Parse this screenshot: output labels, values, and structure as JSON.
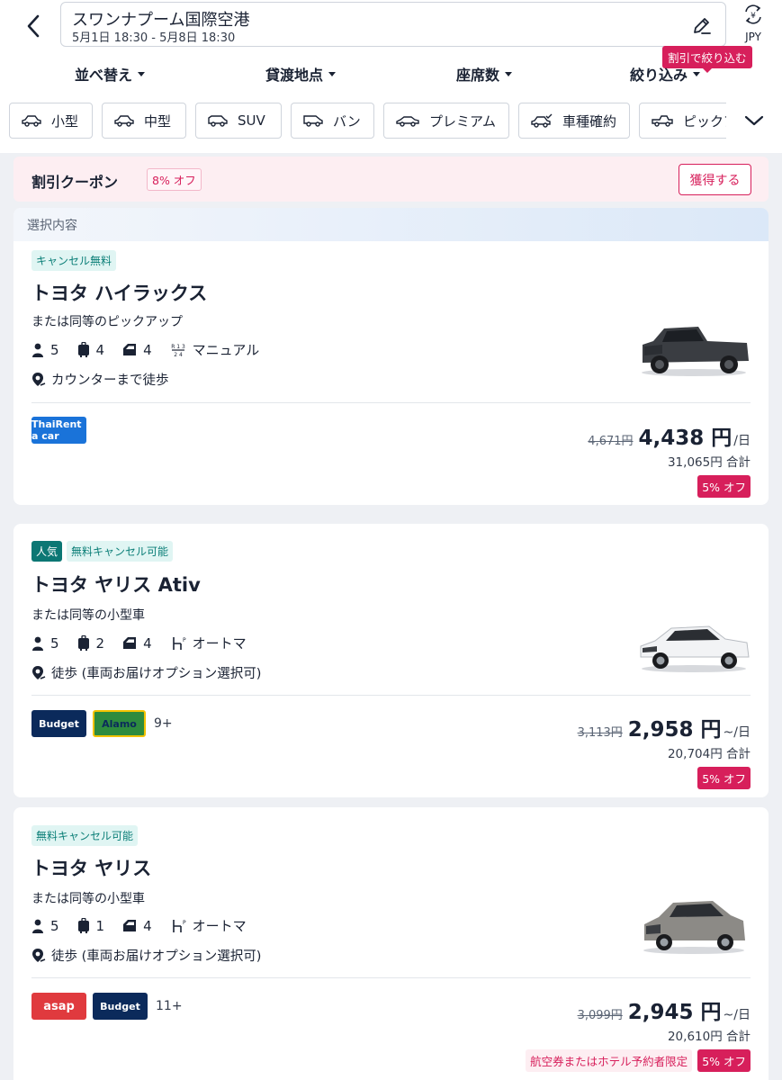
{
  "header": {
    "title": "スワンナプーム国際空港",
    "dates": "5月1日 18:30 - 5月8日 18:30",
    "currency": "JPY",
    "discount_tooltip": "割引で絞り込む"
  },
  "sort_bar": {
    "sort": "並べ替え",
    "pickup": "貸渡地点",
    "seats": "座席数",
    "filter": "絞り込み"
  },
  "chips": [
    {
      "label": "小型",
      "icon": "car-icon"
    },
    {
      "label": "中型",
      "icon": "car-icon"
    },
    {
      "label": "SUV",
      "icon": "suv-icon"
    },
    {
      "label": "バン",
      "icon": "van-icon"
    },
    {
      "label": "プレミアム",
      "icon": "premium-car-icon"
    },
    {
      "label": "車種確約",
      "icon": "car-check-icon"
    },
    {
      "label": "ピックア",
      "icon": "pickup-icon"
    }
  ],
  "coupon": {
    "title": "割引クーポン",
    "badge": "8% オフ",
    "button": "獲得する"
  },
  "selection_label": "選択内容",
  "cars": [
    {
      "tags": [
        "キャンセル無料"
      ],
      "name": "トヨタ ハイラックス",
      "subtitle": "または同等のピックアップ",
      "seats": "5",
      "bags_large": "4",
      "doors": "4",
      "transmission": "マニュアル",
      "location": "カウンターまで徒歩",
      "vendors": [
        "ThaiRent a car"
      ],
      "vendor_more": "",
      "price_old": "4,671円",
      "price": "4,438 円",
      "price_unit": "/日",
      "total": "31,065円 合計",
      "limited": "",
      "discount": "5% オフ"
    },
    {
      "tags": [
        "人気",
        "無料キャンセル可能"
      ],
      "name": "トヨタ ヤリス Ativ",
      "subtitle": "または同等の小型車",
      "seats": "5",
      "bags_large": "2",
      "doors": "4",
      "transmission": "オートマ",
      "location": "徒歩 (車両お届けオプション選択可)",
      "vendors": [
        "Budget",
        "Alamo"
      ],
      "vendor_more": "9+",
      "price_old": "3,113円",
      "price": "2,958 円",
      "price_unit": "~/日",
      "total": "20,704円 合計",
      "limited": "",
      "discount": "5% オフ"
    },
    {
      "tags": [
        "無料キャンセル可能"
      ],
      "name": "トヨタ ヤリス",
      "subtitle": "または同等の小型車",
      "seats": "5",
      "bags_large": "1",
      "doors": "4",
      "transmission": "オートマ",
      "location": "徒歩 (車両お届けオプション選択可)",
      "vendors": [
        "asap",
        "Budget"
      ],
      "vendor_more": "11+",
      "price_old": "3,099円",
      "price": "2,945 円",
      "price_unit": "~/日",
      "total": "20,610円 合計",
      "limited": "航空券またはホテル予約者限定",
      "discount": "5% オフ"
    }
  ],
  "colors": {
    "accent": "#d71f5b",
    "teal": "#0c7774",
    "text": "#1a2233"
  }
}
